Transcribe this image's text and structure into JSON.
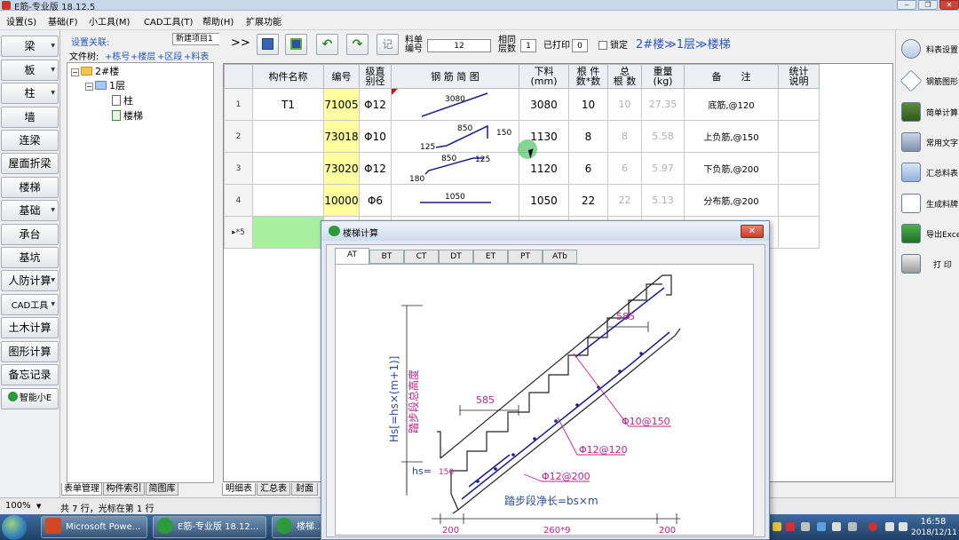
{
  "window": {
    "title": "E筋-专业版 18.12.5",
    "controls": [
      "‒",
      "❐",
      "✕"
    ]
  },
  "menu": [
    "设置(S)",
    "基础(F)",
    "小工具(M)",
    "CAD工具(T)",
    "帮助(H)",
    "扩展功能"
  ],
  "left_nav": [
    {
      "label": "梁",
      "dropdown": true
    },
    {
      "label": "板",
      "dropdown": true
    },
    {
      "label": "柱",
      "dropdown": true
    },
    {
      "label": "墙",
      "dropdown": false
    },
    {
      "label": "连梁",
      "dropdown": false
    },
    {
      "label": "屋面折梁",
      "dropdown": false
    },
    {
      "label": "楼梯",
      "dropdown": false
    },
    {
      "label": "基础",
      "dropdown": true
    },
    {
      "label": "承台",
      "dropdown": false
    },
    {
      "label": "基坑",
      "dropdown": false
    },
    {
      "label": "人防计算",
      "dropdown": true
    },
    {
      "label": "CAD工具",
      "dropdown": true
    },
    {
      "label": "土木计算",
      "dropdown": false
    },
    {
      "label": "图形计算",
      "dropdown": false
    },
    {
      "label": "备忘记录",
      "dropdown": false
    },
    {
      "label": "智能小E",
      "dropdown": false
    }
  ],
  "tree_panel": {
    "project_label": "设置关联:",
    "project_value": "新建项目1",
    "filetree_label": "文件树:",
    "filetree_actions": [
      "+栋号",
      "+楼层",
      "+区段",
      "+料表"
    ],
    "nodes": {
      "building": "2#楼",
      "floor": "1层",
      "item1": "柱",
      "item2": "楼梯"
    },
    "tabs": [
      "表单管理",
      "构件索引",
      "简图库"
    ]
  },
  "toolbar": {
    "expand": ">>",
    "labels": {
      "sheet_top": "料单",
      "sheet_bottom": "编号",
      "same_top": "相同",
      "same_bottom": "层数",
      "printed": "已打印",
      "lock": "锁定"
    },
    "sheet_no": "12",
    "same_layers": "1",
    "printed_count": "0",
    "breadcrumb": "2#楼≫1层≫楼梯"
  },
  "table": {
    "headers": [
      "",
      "构件名称",
      "编号",
      "级直\n别径",
      "钢 筋 简 图",
      "下料\n(mm)",
      "根 件\n数*数",
      "总\n根 数",
      "重量\n(kg)",
      "备　　注",
      "统计\n说明"
    ],
    "rows": [
      {
        "n": "1",
        "name": "T1",
        "code": "71005",
        "grade": "Φ12",
        "shape_dims": [
          "3080"
        ],
        "cut": "3080",
        "count": "10",
        "total": "10",
        "weight": "27.35",
        "note": "底筋,@120"
      },
      {
        "n": "2",
        "name": "",
        "code": "73018",
        "grade": "Φ10",
        "shape_dims": [
          "850",
          "150",
          "125"
        ],
        "cut": "1130",
        "count": "8",
        "total": "8",
        "weight": "5.58",
        "note": "上负筋,@150"
      },
      {
        "n": "3",
        "name": "",
        "code": "73020",
        "grade": "Φ12",
        "shape_dims": [
          "850",
          "125",
          "180"
        ],
        "cut": "1120",
        "count": "6",
        "total": "6",
        "weight": "5.97",
        "note": "下负筋,@200"
      },
      {
        "n": "4",
        "name": "",
        "code": "10000",
        "grade": "Φ6",
        "shape_dims": [
          "1050"
        ],
        "cut": "1050",
        "count": "22",
        "total": "22",
        "weight": "5.13",
        "note": "分布筋,@200"
      }
    ],
    "new_row_marker": "▸*5",
    "tabs": [
      "明细表",
      "汇总表",
      "封面"
    ]
  },
  "right_panel": [
    "料表设置",
    "钢筋图形",
    "简单计算",
    "常用文字",
    "汇总料表",
    "生成料牌",
    "导出Excel",
    "打 印"
  ],
  "status": {
    "zoom": "100%",
    "info": "共 7 行，光标在第 1 行"
  },
  "taskbar": {
    "tasks": [
      "Microsoft Powe...",
      "E筋-专业版 18.12...",
      "楼梯..."
    ],
    "time": "16:58",
    "date": "2018/12/11"
  },
  "dialog": {
    "title": "楼梯计算",
    "tabs": [
      "AT",
      "BT",
      "CT",
      "DT",
      "ET",
      "PT",
      "ATb"
    ],
    "drawing": {
      "dim_top": "585",
      "dim_mid": "585",
      "rebar_top": "Φ10@150",
      "rebar_mid": "Φ12@120",
      "rebar_bot": "Φ12@200",
      "hs_label": "hs=",
      "hs_value": "150",
      "vertical_label": "Hs[=hs×(m+1)]",
      "vertical_label2": "踏步段总高度",
      "bottom_label": "踏步段净长=bs×m",
      "dim_left": "200",
      "dim_center": "260*9",
      "dim_right": "200"
    }
  },
  "colors": {
    "accent_blue": "#2a56b8",
    "rebar": "#1d1d8a",
    "annotation": "#c0208a",
    "new_row": "#a8f0a0",
    "code_cell": "#ffffa0"
  }
}
